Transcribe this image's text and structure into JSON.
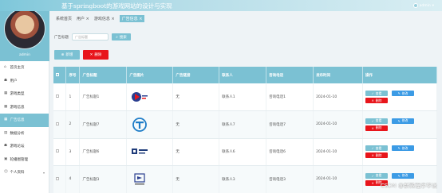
{
  "app": {
    "title": "基于springboot的游戏网站的设计与实现",
    "user": "admin",
    "collapse_label": "收起菜单",
    "sidebar_username": "admin"
  },
  "sidebar": {
    "items": [
      {
        "label": "首页主页",
        "icon": "home-icon"
      },
      {
        "label": "用户",
        "icon": "users-icon"
      },
      {
        "label": "游戏类型",
        "icon": "grid-icon"
      },
      {
        "label": "游戏信息",
        "icon": "grid-icon"
      },
      {
        "label": "广告信息",
        "icon": "grid-icon"
      },
      {
        "label": "数据分析",
        "icon": "chart-icon"
      },
      {
        "label": "游戏论坛",
        "icon": "users-icon"
      },
      {
        "label": "轮播图管理",
        "icon": "image-icon"
      },
      {
        "label": "个人资料",
        "icon": "user-icon"
      }
    ]
  },
  "tabs": [
    "系统首页",
    "用户",
    "游戏信息",
    "广告信息"
  ],
  "search": {
    "label": "广告标题",
    "placeholder": "广告标题",
    "button": "搜索"
  },
  "actions": {
    "add": "新增",
    "delete": "删除"
  },
  "table": {
    "headers": [
      "序号",
      "广告标题",
      "广告图片",
      "广告链接",
      "联系人",
      "咨询电话",
      "发布时间",
      "操作"
    ],
    "rows": [
      {
        "index": "1",
        "title": "广告标题1",
        "link": "无",
        "contact": "联系人1",
        "phone": "咨询电话1",
        "date": "2024-01-10"
      },
      {
        "index": "2",
        "title": "广告标题7",
        "link": "无",
        "contact": "联系人7",
        "phone": "咨询电话7",
        "date": "2024-01-10"
      },
      {
        "index": "3",
        "title": "广告标题6",
        "link": "无",
        "contact": "联系人6",
        "phone": "咨询电话6",
        "date": "2024-01-10"
      },
      {
        "index": "4",
        "title": "广告标题3",
        "link": "无",
        "contact": "联系人3",
        "phone": "咨询电话3",
        "date": "2024-01-10"
      }
    ],
    "op_labels": {
      "view": "查看",
      "edit": "修改",
      "delete": "删除"
    }
  },
  "watermark": "CSDN @新微程序毕设",
  "colors": {
    "accent": "#7bc1d3",
    "danger": "#e8151b",
    "edit": "#3c9be5"
  }
}
